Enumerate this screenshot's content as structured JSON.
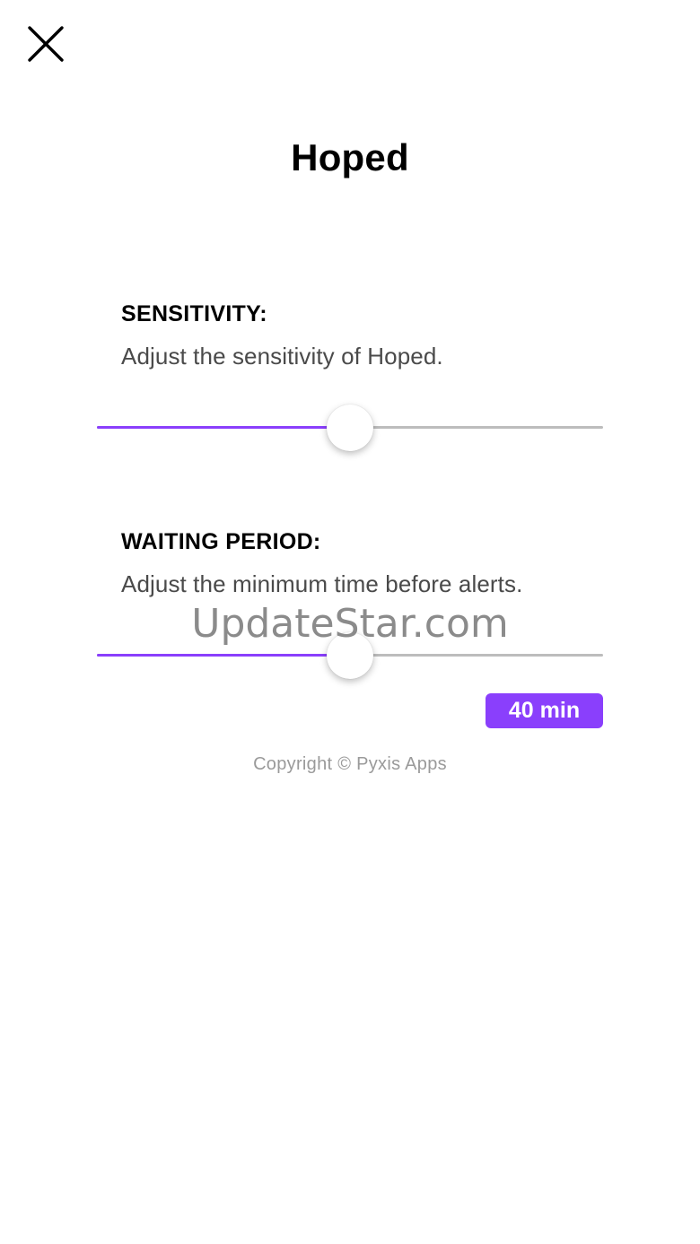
{
  "header": {
    "title": "Hoped"
  },
  "sensitivity": {
    "label": "SENSITIVITY:",
    "description": "Adjust the sensitivity of Hoped.",
    "level": 0.5
  },
  "waiting_period": {
    "label": "WAITING PERIOD:",
    "description": "Adjust the minimum time before alerts.",
    "level": 0.5,
    "value_display": "40 min"
  },
  "footer": {
    "copyright": "Copyright © Pyxis Apps"
  },
  "watermark": {
    "text": "UpdateStar.com"
  },
  "colors": {
    "accent": "#8a3ffc",
    "track": "#bdbdbd"
  },
  "icons": {
    "close": "close-icon"
  }
}
